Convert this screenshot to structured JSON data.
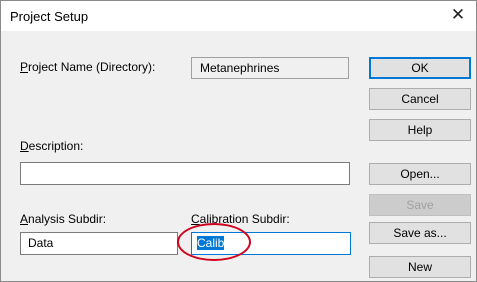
{
  "window": {
    "title": "Project Setup",
    "close_glyph": "✕"
  },
  "project_name": {
    "label_mnemonic": "P",
    "label_rest": "roject Name (Directory):",
    "value": "Metanephrines"
  },
  "description": {
    "label_mnemonic": "D",
    "label_rest": "escription:",
    "value": ""
  },
  "analysis_subdir": {
    "label_mnemonic": "A",
    "label_rest": "nalysis Subdir:",
    "value": "Data"
  },
  "calibration_subdir": {
    "label_mnemonic": "C",
    "label_rest": "alibration Subdir:",
    "value": "Calib"
  },
  "buttons": {
    "ok": "OK",
    "cancel": "Cancel",
    "help": "Help",
    "open": "Open...",
    "save": "Save",
    "save_as": "Save as...",
    "new": "New"
  },
  "annotation": {
    "color": "#d0021b",
    "shape": "ellipse"
  }
}
